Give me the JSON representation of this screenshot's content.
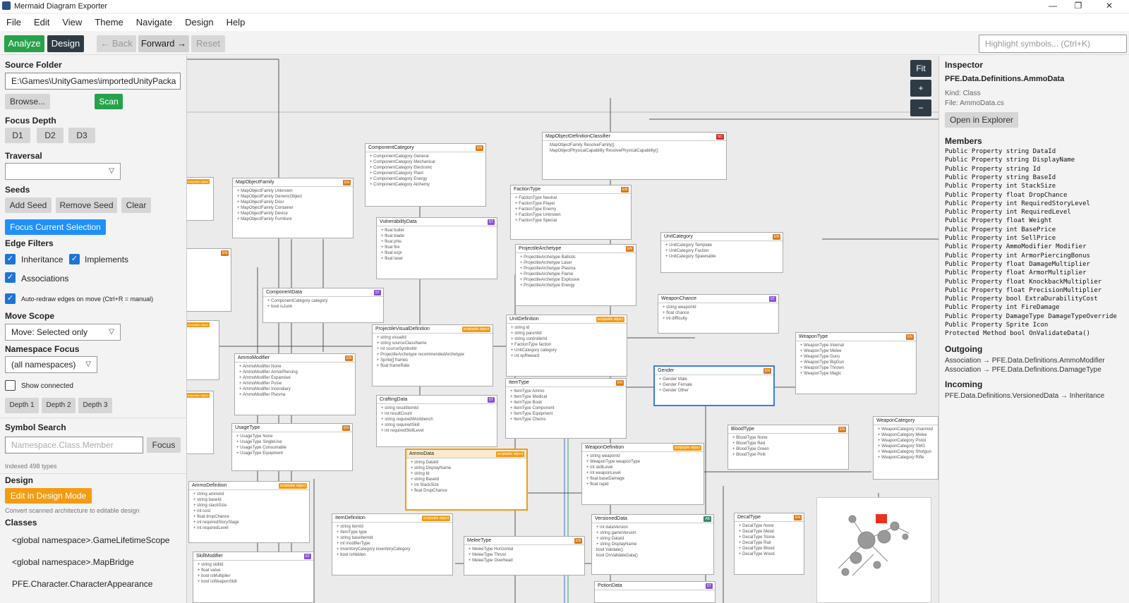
{
  "window": {
    "title": "Mermaid Diagram Exporter",
    "min": "—",
    "max": "❐",
    "close": "✕"
  },
  "menu": [
    "File",
    "Edit",
    "View",
    "Theme",
    "Navigate",
    "Design",
    "Help"
  ],
  "toolbar": {
    "analyze": "Analyze",
    "design": "Design",
    "back": "← Back",
    "forward": "Forward →",
    "reset": "Reset",
    "highlight_placeholder": "Highlight symbols... (Ctrl+K)"
  },
  "left": {
    "source_folder_label": "Source Folder",
    "source_folder_value": "E:\\Games\\UnityGames\\importedUnityPacka",
    "browse": "Browse...",
    "scan": "Scan",
    "focus_depth_label": "Focus Depth",
    "d1": "D1",
    "d2": "D2",
    "d3": "D3",
    "traversal_label": "Traversal",
    "seeds_label": "Seeds",
    "add_seed": "Add Seed",
    "remove_seed": "Remove Seed",
    "clear": "Clear",
    "focus_current": "Focus Current Selection",
    "edge_filters_label": "Edge Filters",
    "inheritance": "Inheritance",
    "implements": "Implements",
    "associations": "Associations",
    "auto_redraw": "Auto-redraw edges on move (Ctrl+R = manual)",
    "move_scope_label": "Move Scope",
    "move_scope_value": "Move: Selected only",
    "namespace_focus_label": "Namespace Focus",
    "namespace_value": "(all namespaces)",
    "show_connected": "Show connected",
    "depth1": "Depth 1",
    "depth2": "Depth 2",
    "depth3": "Depth 3",
    "symbol_search_label": "Symbol Search",
    "symbol_placeholder": "Namespace.Class.Member",
    "focus": "Focus",
    "indexed": "Indexed 498 types",
    "design_label": "Design",
    "edit_design": "Edit in Design Mode",
    "convert_note": "Convert scanned architecture to editable design",
    "classes_label": "Classes",
    "classes": [
      "<global namespace>.GameLifetimeScope",
      "<global namespace>.MapBridge",
      "PFE.Character.CharacterAppearance"
    ]
  },
  "canvas": {
    "fit": "Fit",
    "zoom_in": "+",
    "zoom_out": "−",
    "nodes": [
      {
        "id": "MapObjectDefinitionClassifier",
        "badge": "SC",
        "members": [
          "MapObjectFamily ResolveFamily()",
          "MapObjectPhysicalCapability ResolvePhysicalCapability()"
        ]
      },
      {
        "id": "ComponentCategory",
        "badge": "EN",
        "members": [
          "+ ComponentCategory General",
          "+ ComponentCategory Mechanical",
          "+ ComponentCategory Electronic",
          "+ ComponentCategory Plant",
          "+ ComponentCategory Energy",
          "+ ComponentCategory Alchemy"
        ]
      },
      {
        "id": "MapObjectFamily",
        "badge": "EN",
        "members": [
          "+ MapObjectFamily Unknown",
          "+ MapObjectFamily GenericObject",
          "+ MapObjectFamily Door",
          "+ MapObjectFamily Container",
          "+ MapObjectFamily Device",
          "+ MapObjectFamily Furniture"
        ]
      },
      {
        "id": "FactionType",
        "badge": "EN",
        "members": [
          "+ FactionType Neutral",
          "+ FactionType Player",
          "+ FactionType Enemy",
          "+ FactionType Unknown",
          "+ FactionType Special"
        ]
      },
      {
        "id": "VulnerabilityData",
        "badge": "ST",
        "members": [
          "+ float bullet",
          "+ float blade",
          "+ float phis",
          "+ float fire",
          "+ float expl",
          "+ float laser"
        ]
      },
      {
        "id": "ProjectileArchetype",
        "badge": "EN",
        "members": [
          "+ ProjectileArchetype Ballistic",
          "+ ProjectileArchetype Laser",
          "+ ProjectileArchetype Plasma",
          "+ ProjectileArchetype Flame",
          "+ ProjectileArchetype Explosive",
          "+ ProjectileArchetype Energy"
        ]
      },
      {
        "id": "UnitCategory",
        "badge": "EN",
        "members": [
          "+ UnitCategory Template",
          "+ UnitCategory Faction",
          "+ UnitCategory Spawnable"
        ]
      },
      {
        "id": "ComponentData",
        "badge": "ST",
        "members": [
          "+ ComponentCategory category",
          "+ bool isJunk"
        ]
      },
      {
        "id": "WeaponChance",
        "badge": "ST",
        "members": [
          "+ string weaponId",
          "+ float chance",
          "+ int difficulty"
        ]
      },
      {
        "id": "ProjectileVisualDefinition",
        "badge": "SO",
        "members": [
          "+ string visualId",
          "+ string sourceClassName",
          "+ int sourceSymbolId",
          "+ ProjectileArchetype recommendedArchetype",
          "+ Sprite[] frames",
          "+ float frameRate"
        ]
      },
      {
        "id": "UnitDefinition",
        "badge": "SO",
        "members": [
          "+ string id",
          "+ string parentId",
          "+ string controllerId",
          "+ FactionType faction",
          "+ UnitCategory category",
          "+ int xpReward"
        ]
      },
      {
        "id": "WeaponType",
        "badge": "EN",
        "members": [
          "+ WeaponType Internal",
          "+ WeaponType Melee",
          "+ WeaponType Guns",
          "+ WeaponType BigGun",
          "+ WeaponType Thrown",
          "+ WeaponType Magic"
        ]
      },
      {
        "id": "AmmoModifier",
        "badge": "EN",
        "members": [
          "+ AmmoModifier None",
          "+ AmmoModifier ArmorPiercing",
          "+ AmmoModifier Expansive",
          "+ AmmoModifier Pulse",
          "+ AmmoModifier Incendiary",
          "+ AmmoModifier Plasma"
        ]
      },
      {
        "id": "Gender",
        "badge": "EN",
        "members": [
          "+ Gender Male",
          "+ Gender Female",
          "+ Gender Other"
        ]
      },
      {
        "id": "ItemType",
        "badge": "EN",
        "members": [
          "+ ItemType Ammo",
          "+ ItemType Medical",
          "+ ItemType Book",
          "+ ItemType Component",
          "+ ItemType Equipment",
          "+ ItemType Chems"
        ]
      },
      {
        "id": "CraftingData",
        "badge": "ST",
        "members": [
          "+ string resultItemId",
          "+ int resultCount",
          "+ string requiredWorkbench",
          "+ string requiredSkill",
          "+ int requiredSkillLevel"
        ]
      },
      {
        "id": "UsageType",
        "badge": "EN",
        "members": [
          "+ UsageType None",
          "+ UsageType SingleUse",
          "+ UsageType Consumable",
          "+ UsageType Equipment"
        ]
      },
      {
        "id": "BloodType",
        "badge": "EN",
        "members": [
          "+ BloodType None",
          "+ BloodType Red",
          "+ BloodType Green",
          "+ BloodType Pink"
        ]
      },
      {
        "id": "WeaponCategory",
        "badge": "",
        "members": [
          "+ WeaponCategory Unarmed",
          "+ WeaponCategory Melee",
          "+ WeaponCategory Pistol",
          "+ WeaponCategory SMG",
          "+ WeaponCategory Shotgun",
          "+ WeaponCategory Rifle"
        ]
      },
      {
        "id": "AmmoData",
        "badge": "SO",
        "members": [
          "+ string DataId",
          "+ string DisplayName",
          "+ string Id",
          "+ string BaseId",
          "+ int StackSize",
          "+ float DropChance"
        ]
      },
      {
        "id": "WeaponDefinition",
        "badge": "SO",
        "members": [
          "+ string weaponId",
          "+ WeaponType weaponType",
          "+ int skillLevel",
          "+ int weaponLevel",
          "+ float baseDamage",
          "+ float rapid"
        ]
      },
      {
        "id": "AmmoDefinition",
        "badge": "SO",
        "members": [
          "+ string ammoId",
          "+ string baseId",
          "+ string stackSize",
          "+ int cost",
          "+ float dropChance",
          "+ int requiredStoryStage",
          "+ int requiredLevel"
        ]
      },
      {
        "id": "ItemDefinition",
        "badge": "SO",
        "members": [
          "+ string itemId",
          "+ ItemType type",
          "+ string baseItemId",
          "+ int modifierType",
          "+ InventoryCategory inventoryCategory",
          "+ bool isHidden"
        ]
      },
      {
        "id": "MeleeType",
        "badge": "EN",
        "members": [
          "+ MeleeType Horizontal",
          "+ MeleeType Thrust",
          "+ MeleeType Overhead"
        ]
      },
      {
        "id": "VersionedData",
        "badge": "AB",
        "members": [
          "+ int dataVersion",
          "+ string gameVersion",
          "+ string DataId",
          "+ string DisplayName",
          "bool Validate()",
          "bool OnValidateData()"
        ]
      },
      {
        "id": "DecalType",
        "badge": "EN",
        "members": [
          "+ DecalType None",
          "+ DecalType Metal",
          "+ DecalType Stone",
          "+ DecalType Rail",
          "+ DecalType Blood",
          "+ DecalType Wood"
        ]
      },
      {
        "id": "SkillModifier",
        "badge": "ST",
        "members": [
          "+ string skillId",
          "+ float value",
          "+ bool isMultiplier",
          "+ bool isWeaponSkill"
        ]
      },
      {
        "id": "PotionData",
        "badge": "ST",
        "members": []
      }
    ],
    "scriptable_tag": "scriptable object"
  },
  "inspector": {
    "title": "Inspector",
    "full_name": "PFE.Data.Definitions.AmmoData",
    "kind": "Kind: Class",
    "file": "File: AmmoData.cs",
    "open_explorer": "Open in Explorer",
    "members_label": "Members",
    "members": [
      "Public Property string DataId",
      "Public Property string DisplayName",
      "Public Property string Id",
      "Public Property string BaseId",
      "Public Property int StackSize",
      "Public Property float DropChance",
      "Public Property int RequiredStoryLevel",
      "Public Property int RequiredLevel",
      "Public Property float Weight",
      "Public Property int BasePrice",
      "Public Property int SellPrice",
      "Public Property AmmoModifier Modifier",
      "Public Property int ArmorPiercingBonus",
      "Public Property float DamageMultiplier",
      "Public Property float ArmorMultiplier",
      "Public Property float KnockbackMultiplier",
      "Public Property float PrecisionMultiplier",
      "Public Property bool ExtraDurabilityCost",
      "Public Property int FireDamage",
      "Public Property DamageType DamageTypeOverride",
      "Public Property Sprite Icon",
      "Protected Method bool OnValidateData()"
    ],
    "outgoing_label": "Outgoing",
    "outgoing": [
      "Association → PFE.Data.Definitions.AmmoModifier",
      "Association → PFE.Data.Definitions.DamageType"
    ],
    "incoming_label": "Incoming",
    "incoming": [
      "PFE.Data.Definitions.VersionedData → Inheritance"
    ]
  }
}
